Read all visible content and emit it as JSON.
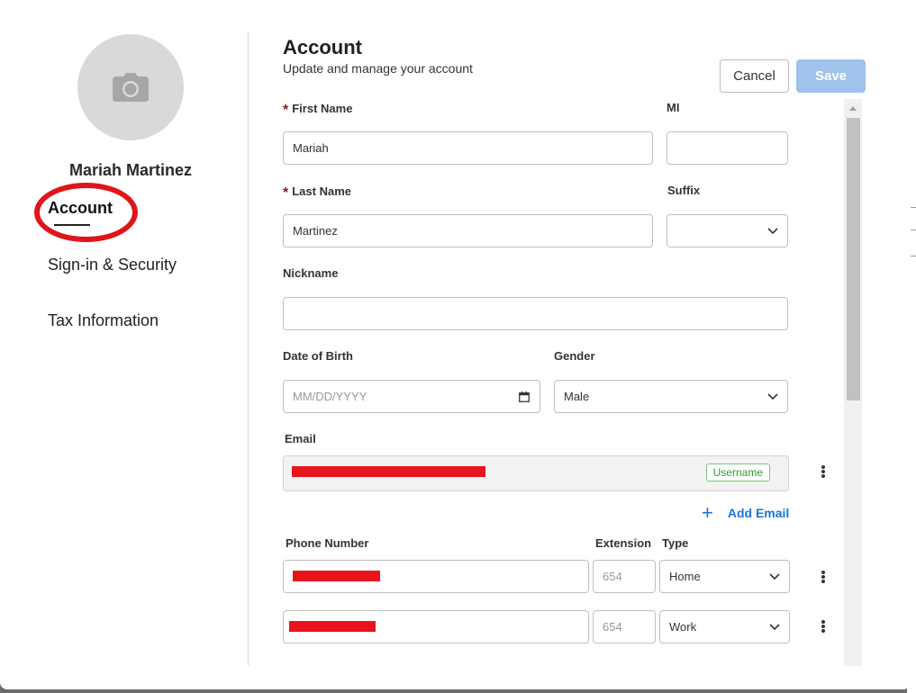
{
  "sidebar": {
    "user_name": "Mariah Martinez",
    "items": [
      {
        "label": "Account",
        "active": true
      },
      {
        "label": "Sign-in & Security",
        "active": false
      },
      {
        "label": "Tax Information",
        "active": false
      }
    ],
    "avatar_icon": "camera-icon"
  },
  "header": {
    "title": "Account",
    "subtitle": "Update and manage your account",
    "cancel_label": "Cancel",
    "save_label": "Save"
  },
  "form": {
    "first_name": {
      "label": "First Name",
      "value": "Mariah",
      "required": true
    },
    "mi": {
      "label": "MI",
      "value": ""
    },
    "last_name": {
      "label": "Last Name",
      "value": "Martinez",
      "required": true
    },
    "suffix": {
      "label": "Suffix",
      "value": ""
    },
    "nickname": {
      "label": "Nickname",
      "value": ""
    },
    "dob": {
      "label": "Date of Birth",
      "placeholder": "MM/DD/YYYY"
    },
    "gender": {
      "label": "Gender",
      "value": "Male"
    },
    "email": {
      "label": "Email",
      "badge": "Username",
      "add_label": "Add Email"
    },
    "phone": {
      "label": "Phone Number",
      "extension_label": "Extension",
      "type_label": "Type",
      "rows": [
        {
          "extension_placeholder": "654",
          "type": "Home"
        },
        {
          "extension_placeholder": "654",
          "type": "Work"
        }
      ]
    }
  },
  "colors": {
    "accent": "#1a73d9",
    "save_disabled": "#9fc3ea",
    "required_marker": "#8b1a1a",
    "badge_green": "#2f9a2f",
    "redaction": "#e8141c",
    "annotation": "#e0141a"
  }
}
